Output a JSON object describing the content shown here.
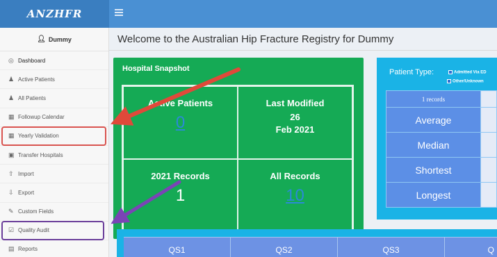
{
  "app": {
    "logo": "ANZHFR"
  },
  "user": {
    "name": "Dummy"
  },
  "sidebar": {
    "items": [
      {
        "label": "Dashboard",
        "icon": "dashboard-icon"
      },
      {
        "label": "Active Patients",
        "icon": "user-icon"
      },
      {
        "label": "All Patients",
        "icon": "users-icon"
      },
      {
        "label": "Followup Calendar",
        "icon": "calendar-icon"
      },
      {
        "label": "Yearly Validation",
        "icon": "table-icon"
      },
      {
        "label": "Transfer Hospitals",
        "icon": "hospital-icon"
      },
      {
        "label": "Import",
        "icon": "upload-icon"
      },
      {
        "label": "Export",
        "icon": "download-icon"
      },
      {
        "label": "Custom Fields",
        "icon": "edit-icon"
      },
      {
        "label": "Quality Audit",
        "icon": "checkbox-icon"
      },
      {
        "label": "Reports",
        "icon": "chart-icon"
      }
    ]
  },
  "main": {
    "welcome": "Welcome to the Australian Hip Fracture Registry for Dummy",
    "snapshot": {
      "title": "Hospital Snapshot",
      "active_label": "Active Patients",
      "active_value": "0",
      "modified_label": "Last Modified",
      "modified_day": "26",
      "modified_month_year": "Feb 2021",
      "records_2021_label": "2021 Records",
      "records_2021_value": "1",
      "all_records_label": "All Records",
      "all_records_value": "10"
    },
    "patient_type": {
      "label": "Patient Type:",
      "options": [
        "Admitted Via ED",
        "Other/Unknown"
      ],
      "records_header": "1 records",
      "rows": [
        "Average",
        "Median",
        "Shortest",
        "Longest"
      ]
    },
    "qs": [
      "QS1",
      "QS2",
      "QS3",
      "Q"
    ]
  },
  "colors": {
    "topbar": "#4a90d3",
    "snapshot_green": "#15aa55",
    "panel_cyan": "#1ab3e6",
    "highlight_red": "#d9534f",
    "highlight_purple": "#6a3d9a"
  }
}
